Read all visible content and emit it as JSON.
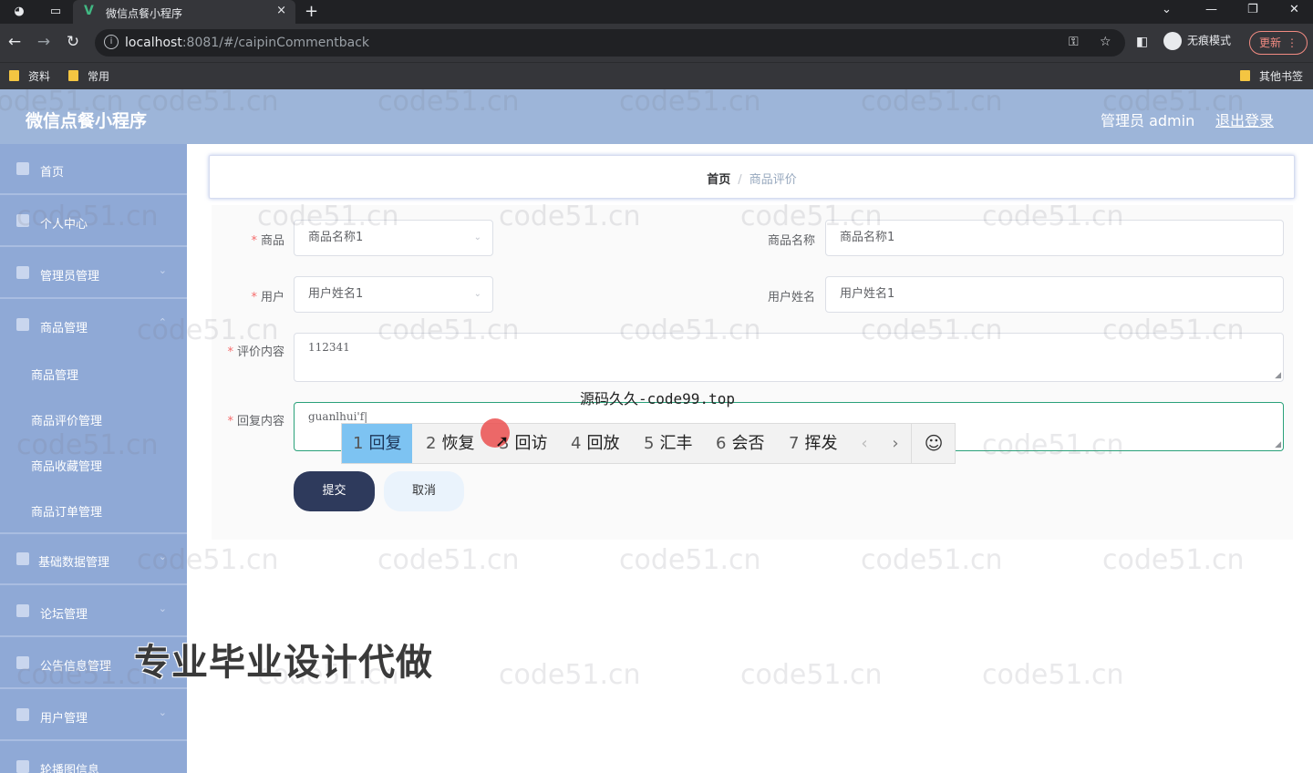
{
  "browser": {
    "tab_title": "微信点餐小程序",
    "tab_close": "×",
    "new_tab": "+",
    "url_host": "localhost",
    "url_rest": ":8081/#/caipinCommentback",
    "incognito_label": "无痕模式",
    "update_label": "更新",
    "bookmarks": [
      "资料",
      "常用"
    ],
    "other_bookmarks": "其他书签"
  },
  "header": {
    "app_title": "微信点餐小程序",
    "admin_label": "管理员 admin",
    "logout_label": "退出登录"
  },
  "sidebar": {
    "items": [
      {
        "label": "首页",
        "icon": "home-icon"
      },
      {
        "label": "个人中心",
        "icon": "user-icon"
      },
      {
        "label": "管理员管理",
        "icon": "chart-icon"
      },
      {
        "label": "商品管理",
        "icon": "pie-icon"
      }
    ],
    "sub_items": [
      "商品管理",
      "商品评价管理",
      "商品收藏管理",
      "商品订单管理"
    ],
    "more_items": [
      {
        "label": "基础数据管理",
        "icon": "data-icon"
      },
      {
        "label": "论坛管理",
        "icon": "forum-icon"
      },
      {
        "label": "公告信息管理",
        "icon": "notice-icon"
      },
      {
        "label": "用户管理",
        "icon": "users-icon"
      },
      {
        "label": "轮播图信息",
        "icon": "image-icon"
      }
    ]
  },
  "breadcrumb": {
    "home": "首页",
    "separator": "/",
    "current": "商品评价"
  },
  "form": {
    "product_label": "商品",
    "product_value": "商品名称1",
    "product_name_label": "商品名称",
    "product_name_value": "商品名称1",
    "user_label": "用户",
    "user_value": "用户姓名1",
    "user_name_label": "用户姓名",
    "user_name_value": "用户姓名1",
    "comment_label": "评价内容",
    "comment_value": "112341",
    "reply_label": "回复内容",
    "reply_value": "guanlhui'f|",
    "submit_label": "提交",
    "cancel_label": "取消"
  },
  "ime": {
    "candidates": [
      {
        "num": "1",
        "text": "回复"
      },
      {
        "num": "2",
        "text": "恢复"
      },
      {
        "num": "3",
        "text": "回访"
      },
      {
        "num": "4",
        "text": "回放"
      },
      {
        "num": "5",
        "text": "汇丰"
      },
      {
        "num": "6",
        "text": "会否"
      },
      {
        "num": "7",
        "text": "挥发"
      }
    ],
    "prev": "‹",
    "next": "›",
    "emoji": "☺"
  },
  "overlay": {
    "source_text": "源码久久-code99.top",
    "promo_text": "专业毕业设计代做",
    "watermark": "code51.cn"
  }
}
